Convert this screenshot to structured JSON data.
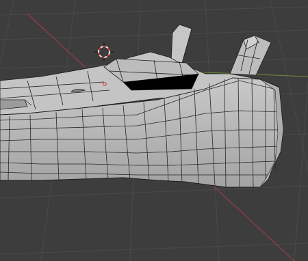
{
  "app": "3D Viewport",
  "colors": {
    "background": "#3d3d3d",
    "grid": "#484848",
    "axis_x": "#9c3b46",
    "axis_y": "#6e8c3a",
    "mesh_face": "#b5b5b5",
    "mesh_edge": "#1e1e1e",
    "cursor": "#cc3333"
  },
  "icons": [
    "3d-cursor-icon",
    "object-origin-icon"
  ]
}
